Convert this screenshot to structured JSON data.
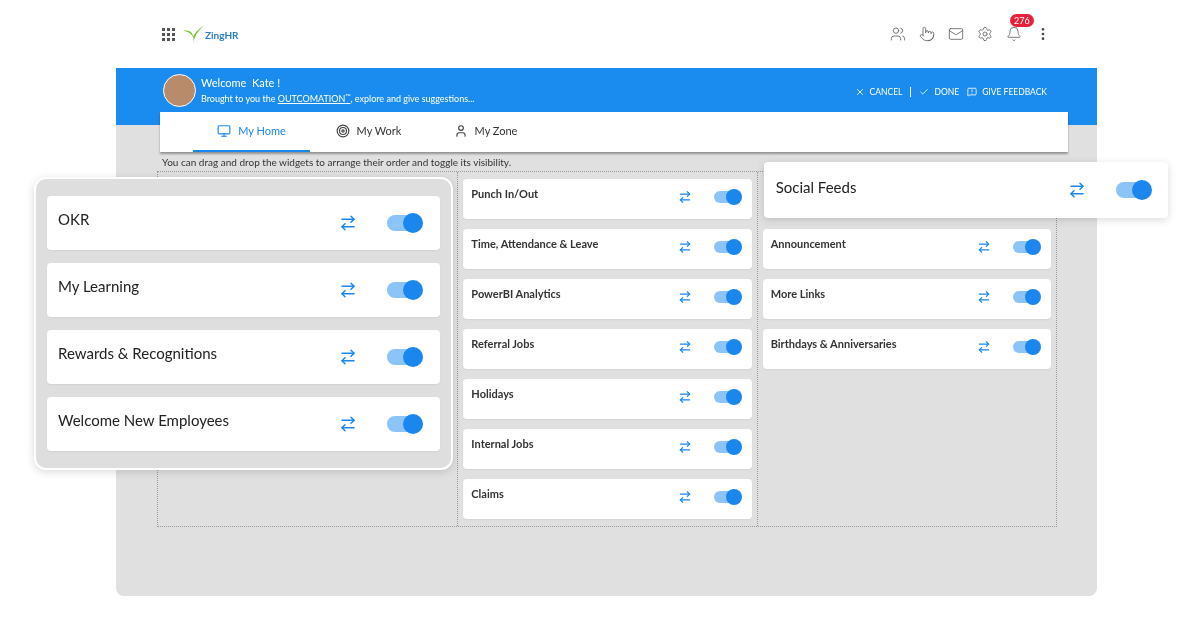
{
  "topbar": {
    "logo": "ZingHR",
    "notification_count": "276"
  },
  "banner": {
    "welcome": "Welcome  Kate !",
    "subtitle_before": "Brought to you the ",
    "link": "OUTCOMATION$^{™}$",
    "subtitle_after": ", explore and give suggestions...",
    "actions": [
      {
        "kind": "cancel",
        "label": "CANCEL"
      },
      {
        "kind": "done",
        "label": "DONE"
      },
      {
        "kind": "feedback",
        "label": "GIVE FEEDBACK"
      }
    ]
  },
  "tabs": [
    {
      "kind": "home",
      "label": "My Home",
      "selected": true
    },
    {
      "kind": "work",
      "label": "My Work",
      "selected": false
    },
    {
      "kind": "zone",
      "label": "My Zone",
      "selected": false
    }
  ],
  "hint": "You can drag and drop the widgets to arrange their order and toggle its visibility.",
  "columns": [
    {
      "highlighted": true,
      "widgets": [
        {
          "title": "OKR",
          "on": true
        },
        {
          "title": "My Learning",
          "on": true
        },
        {
          "title": "Rewards & Recognitions",
          "on": true
        },
        {
          "title": "Welcome New Employees",
          "on": true
        }
      ]
    },
    {
      "highlighted": false,
      "widgets": [
        {
          "title": "Punch In/Out",
          "on": true,
          "highlighted": false
        },
        {
          "title": "Time, Attendance & Leave",
          "on": true,
          "highlighted": false
        },
        {
          "title": "PowerBI Analytics",
          "on": true,
          "highlighted": false
        },
        {
          "title": "Referral Jobs",
          "on": true,
          "highlighted": false
        },
        {
          "title": "Holidays",
          "on": true,
          "highlighted": false
        },
        {
          "title": "Internal Jobs",
          "on": true,
          "highlighted": false
        },
        {
          "title": "Claims",
          "on": true,
          "highlighted": false
        }
      ]
    },
    {
      "highlighted": false,
      "widgets": [
        {
          "title": "Social Feeds",
          "on": true,
          "highlighted": true
        },
        {
          "title": "Announcement",
          "on": true,
          "highlighted": false
        },
        {
          "title": "More Links",
          "on": true,
          "highlighted": false
        },
        {
          "title": "Birthdays & Anniversaries",
          "on": true,
          "highlighted": false
        }
      ]
    }
  ]
}
